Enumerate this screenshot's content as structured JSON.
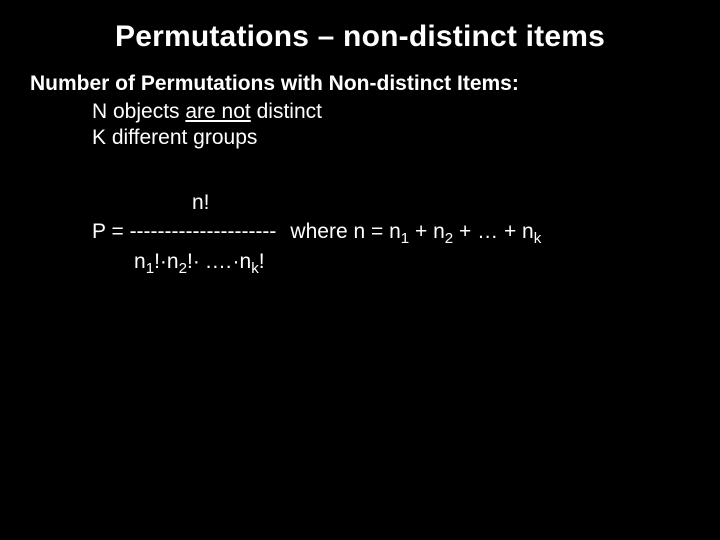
{
  "title": "Permutations – non-distinct items",
  "subhead": "Number of Permutations with Non-distinct Items:",
  "line1_pre": "N objects ",
  "line1_under": "are not",
  "line1_post": " distinct",
  "line2": "K different groups",
  "numerator": "n!",
  "p_eq": "P = ",
  "dashes": "---------------------",
  "where_pre": "where n = n",
  "sub1": "1",
  "where_mid1": " + n",
  "sub2": "2",
  "where_mid2": " + … + n",
  "subk": "k",
  "den_n1": "n",
  "den_s1": "1",
  "den_bang_dot1": "!·n",
  "den_s2": "2",
  "den_bang_dot2": "!· .…·n",
  "den_sk": "k",
  "den_tail": "!"
}
